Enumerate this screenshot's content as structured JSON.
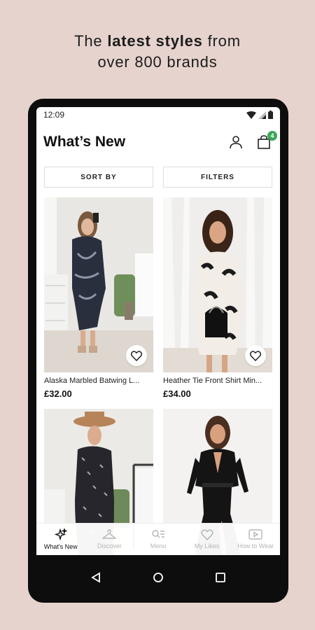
{
  "promo": {
    "line1_pre": "The ",
    "line1_bold": "latest styles",
    "line1_post": " from",
    "line2": "over 800 brands"
  },
  "status": {
    "time": "12:09"
  },
  "header": {
    "title": "What’s New",
    "bag_count": "4"
  },
  "filters": {
    "sort_label": "SORT BY",
    "filter_label": "FILTERS"
  },
  "products": [
    {
      "name": "Alaska Marbled Batwing L...",
      "price": "£32.00"
    },
    {
      "name": "Heather Tie Front Shirt Min...",
      "price": "£34.00"
    },
    {
      "name": "",
      "price": ""
    },
    {
      "name": "",
      "price": ""
    }
  ],
  "nav": [
    {
      "label": "What's New",
      "icon": "sparkle-icon",
      "active": true
    },
    {
      "label": "Discover",
      "icon": "hanger-icon",
      "active": false
    },
    {
      "label": "Menu",
      "icon": "menu-icon",
      "active": false
    },
    {
      "label": "My Likes",
      "icon": "heart-icon",
      "active": false
    },
    {
      "label": "How to Wear",
      "icon": "play-icon",
      "active": false
    }
  ],
  "colors": {
    "background": "#e6d3cd",
    "badge": "#3aa657",
    "phone": "#0d0d0d"
  }
}
